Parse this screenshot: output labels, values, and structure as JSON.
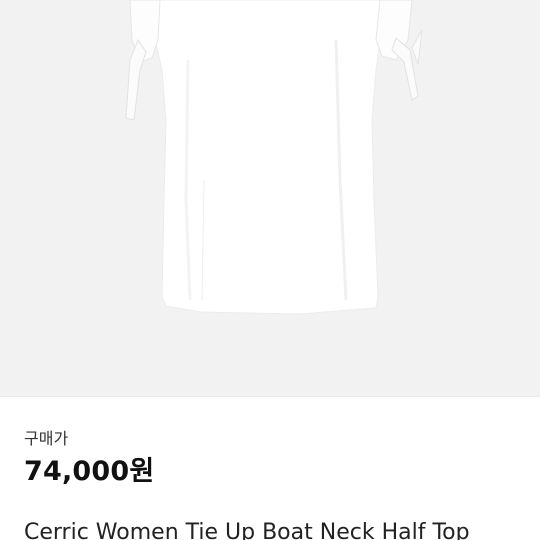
{
  "product": {
    "image_alt_icon": "shirt-icon",
    "price_label": "구매가",
    "price": "74,000원",
    "title": "Cerric Women Tie Up Boat Neck Half Top"
  },
  "colors": {
    "image_background": "#f2f2f2",
    "garment": "#ffffff",
    "text_primary": "#111111",
    "text_secondary": "#333333"
  }
}
